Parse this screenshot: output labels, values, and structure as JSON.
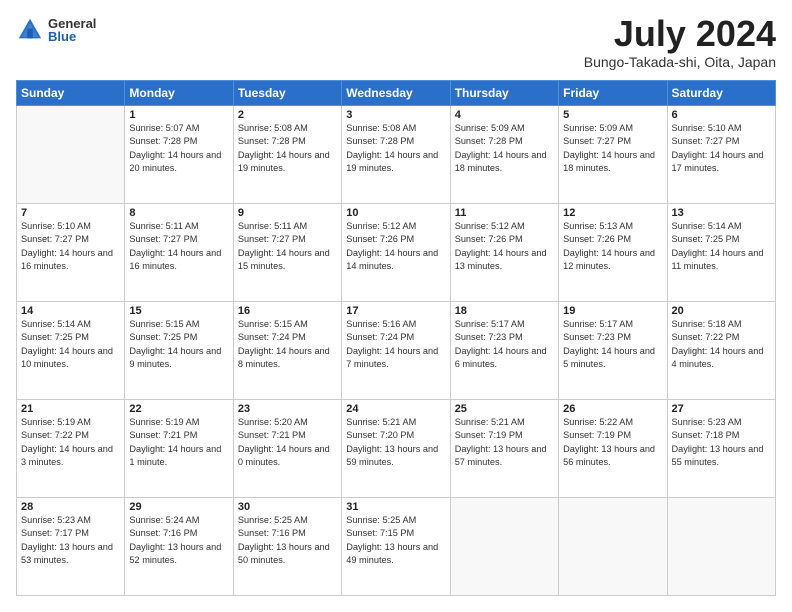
{
  "logo": {
    "general": "General",
    "blue": "Blue"
  },
  "title": "July 2024",
  "subtitle": "Bungo-Takada-shi, Oita, Japan",
  "days_header": [
    "Sunday",
    "Monday",
    "Tuesday",
    "Wednesday",
    "Thursday",
    "Friday",
    "Saturday"
  ],
  "weeks": [
    [
      {
        "day": "",
        "sunrise": "",
        "sunset": "",
        "daylight": ""
      },
      {
        "day": "1",
        "sunrise": "Sunrise: 5:07 AM",
        "sunset": "Sunset: 7:28 PM",
        "daylight": "Daylight: 14 hours and 20 minutes."
      },
      {
        "day": "2",
        "sunrise": "Sunrise: 5:08 AM",
        "sunset": "Sunset: 7:28 PM",
        "daylight": "Daylight: 14 hours and 19 minutes."
      },
      {
        "day": "3",
        "sunrise": "Sunrise: 5:08 AM",
        "sunset": "Sunset: 7:28 PM",
        "daylight": "Daylight: 14 hours and 19 minutes."
      },
      {
        "day": "4",
        "sunrise": "Sunrise: 5:09 AM",
        "sunset": "Sunset: 7:28 PM",
        "daylight": "Daylight: 14 hours and 18 minutes."
      },
      {
        "day": "5",
        "sunrise": "Sunrise: 5:09 AM",
        "sunset": "Sunset: 7:27 PM",
        "daylight": "Daylight: 14 hours and 18 minutes."
      },
      {
        "day": "6",
        "sunrise": "Sunrise: 5:10 AM",
        "sunset": "Sunset: 7:27 PM",
        "daylight": "Daylight: 14 hours and 17 minutes."
      }
    ],
    [
      {
        "day": "7",
        "sunrise": "Sunrise: 5:10 AM",
        "sunset": "Sunset: 7:27 PM",
        "daylight": "Daylight: 14 hours and 16 minutes."
      },
      {
        "day": "8",
        "sunrise": "Sunrise: 5:11 AM",
        "sunset": "Sunset: 7:27 PM",
        "daylight": "Daylight: 14 hours and 16 minutes."
      },
      {
        "day": "9",
        "sunrise": "Sunrise: 5:11 AM",
        "sunset": "Sunset: 7:27 PM",
        "daylight": "Daylight: 14 hours and 15 minutes."
      },
      {
        "day": "10",
        "sunrise": "Sunrise: 5:12 AM",
        "sunset": "Sunset: 7:26 PM",
        "daylight": "Daylight: 14 hours and 14 minutes."
      },
      {
        "day": "11",
        "sunrise": "Sunrise: 5:12 AM",
        "sunset": "Sunset: 7:26 PM",
        "daylight": "Daylight: 14 hours and 13 minutes."
      },
      {
        "day": "12",
        "sunrise": "Sunrise: 5:13 AM",
        "sunset": "Sunset: 7:26 PM",
        "daylight": "Daylight: 14 hours and 12 minutes."
      },
      {
        "day": "13",
        "sunrise": "Sunrise: 5:14 AM",
        "sunset": "Sunset: 7:25 PM",
        "daylight": "Daylight: 14 hours and 11 minutes."
      }
    ],
    [
      {
        "day": "14",
        "sunrise": "Sunrise: 5:14 AM",
        "sunset": "Sunset: 7:25 PM",
        "daylight": "Daylight: 14 hours and 10 minutes."
      },
      {
        "day": "15",
        "sunrise": "Sunrise: 5:15 AM",
        "sunset": "Sunset: 7:25 PM",
        "daylight": "Daylight: 14 hours and 9 minutes."
      },
      {
        "day": "16",
        "sunrise": "Sunrise: 5:15 AM",
        "sunset": "Sunset: 7:24 PM",
        "daylight": "Daylight: 14 hours and 8 minutes."
      },
      {
        "day": "17",
        "sunrise": "Sunrise: 5:16 AM",
        "sunset": "Sunset: 7:24 PM",
        "daylight": "Daylight: 14 hours and 7 minutes."
      },
      {
        "day": "18",
        "sunrise": "Sunrise: 5:17 AM",
        "sunset": "Sunset: 7:23 PM",
        "daylight": "Daylight: 14 hours and 6 minutes."
      },
      {
        "day": "19",
        "sunrise": "Sunrise: 5:17 AM",
        "sunset": "Sunset: 7:23 PM",
        "daylight": "Daylight: 14 hours and 5 minutes."
      },
      {
        "day": "20",
        "sunrise": "Sunrise: 5:18 AM",
        "sunset": "Sunset: 7:22 PM",
        "daylight": "Daylight: 14 hours and 4 minutes."
      }
    ],
    [
      {
        "day": "21",
        "sunrise": "Sunrise: 5:19 AM",
        "sunset": "Sunset: 7:22 PM",
        "daylight": "Daylight: 14 hours and 3 minutes."
      },
      {
        "day": "22",
        "sunrise": "Sunrise: 5:19 AM",
        "sunset": "Sunset: 7:21 PM",
        "daylight": "Daylight: 14 hours and 1 minute."
      },
      {
        "day": "23",
        "sunrise": "Sunrise: 5:20 AM",
        "sunset": "Sunset: 7:21 PM",
        "daylight": "Daylight: 14 hours and 0 minutes."
      },
      {
        "day": "24",
        "sunrise": "Sunrise: 5:21 AM",
        "sunset": "Sunset: 7:20 PM",
        "daylight": "Daylight: 13 hours and 59 minutes."
      },
      {
        "day": "25",
        "sunrise": "Sunrise: 5:21 AM",
        "sunset": "Sunset: 7:19 PM",
        "daylight": "Daylight: 13 hours and 57 minutes."
      },
      {
        "day": "26",
        "sunrise": "Sunrise: 5:22 AM",
        "sunset": "Sunset: 7:19 PM",
        "daylight": "Daylight: 13 hours and 56 minutes."
      },
      {
        "day": "27",
        "sunrise": "Sunrise: 5:23 AM",
        "sunset": "Sunset: 7:18 PM",
        "daylight": "Daylight: 13 hours and 55 minutes."
      }
    ],
    [
      {
        "day": "28",
        "sunrise": "Sunrise: 5:23 AM",
        "sunset": "Sunset: 7:17 PM",
        "daylight": "Daylight: 13 hours and 53 minutes."
      },
      {
        "day": "29",
        "sunrise": "Sunrise: 5:24 AM",
        "sunset": "Sunset: 7:16 PM",
        "daylight": "Daylight: 13 hours and 52 minutes."
      },
      {
        "day": "30",
        "sunrise": "Sunrise: 5:25 AM",
        "sunset": "Sunset: 7:16 PM",
        "daylight": "Daylight: 13 hours and 50 minutes."
      },
      {
        "day": "31",
        "sunrise": "Sunrise: 5:25 AM",
        "sunset": "Sunset: 7:15 PM",
        "daylight": "Daylight: 13 hours and 49 minutes."
      },
      {
        "day": "",
        "sunrise": "",
        "sunset": "",
        "daylight": ""
      },
      {
        "day": "",
        "sunrise": "",
        "sunset": "",
        "daylight": ""
      },
      {
        "day": "",
        "sunrise": "",
        "sunset": "",
        "daylight": ""
      }
    ]
  ]
}
